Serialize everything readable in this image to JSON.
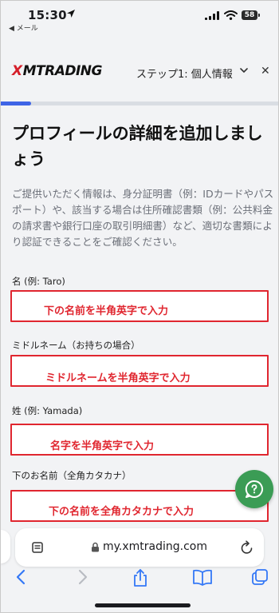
{
  "status_bar": {
    "time": "15:30",
    "back_app": "◀ メール",
    "battery": "58"
  },
  "header": {
    "logo_mark": "X",
    "logo_text": "MTRADING",
    "step_label": "ステップ1: 個人情報",
    "close_glyph": "✕"
  },
  "progress": {
    "fraction": 0.11
  },
  "main": {
    "title": "プロフィールの詳細を追加しましょう",
    "description": "ご提供いただく情報は、身分証明書（例：IDカードやパスポート）や、該当する場合は住所確認書類（例：公共料金の請求書や銀行口座の取引明細書）など、適切な書類により認証できることをご確認ください。"
  },
  "form": {
    "fields": [
      {
        "label": "名 (例: Taro)",
        "annotation": "下の名前を半角英字で入力"
      },
      {
        "label": "ミドルネーム（お持ちの場合）",
        "annotation": "ミドルネームを半角英字で入力"
      },
      {
        "label": "姓 (例: Yamada)",
        "annotation": "名字を半角英字で入力"
      },
      {
        "label": "下のお名前（全角カタカナ）",
        "annotation": "下の名前を全角カタカナで入力"
      }
    ]
  },
  "browser": {
    "url": "my.xmtrading.com"
  },
  "colors": {
    "brand_red": "#d51f2a",
    "annotation_red": "#e0262f",
    "progress_blue": "#3e64e6",
    "help_green": "#3b9c55",
    "safari_blue": "#3478f6"
  },
  "icons": {
    "location": "location-arrow-icon",
    "signal": "cellular-signal-icon",
    "wifi": "wifi-icon",
    "chevron": "chevron-down-icon",
    "help": "chat-help-icon",
    "reader": "reader-mode-icon",
    "lock": "lock-icon",
    "reload": "reload-icon",
    "back": "back-arrow-icon",
    "forward": "forward-arrow-icon",
    "share": "share-icon",
    "bookmarks": "bookmarks-icon",
    "tabs": "tabs-icon"
  }
}
